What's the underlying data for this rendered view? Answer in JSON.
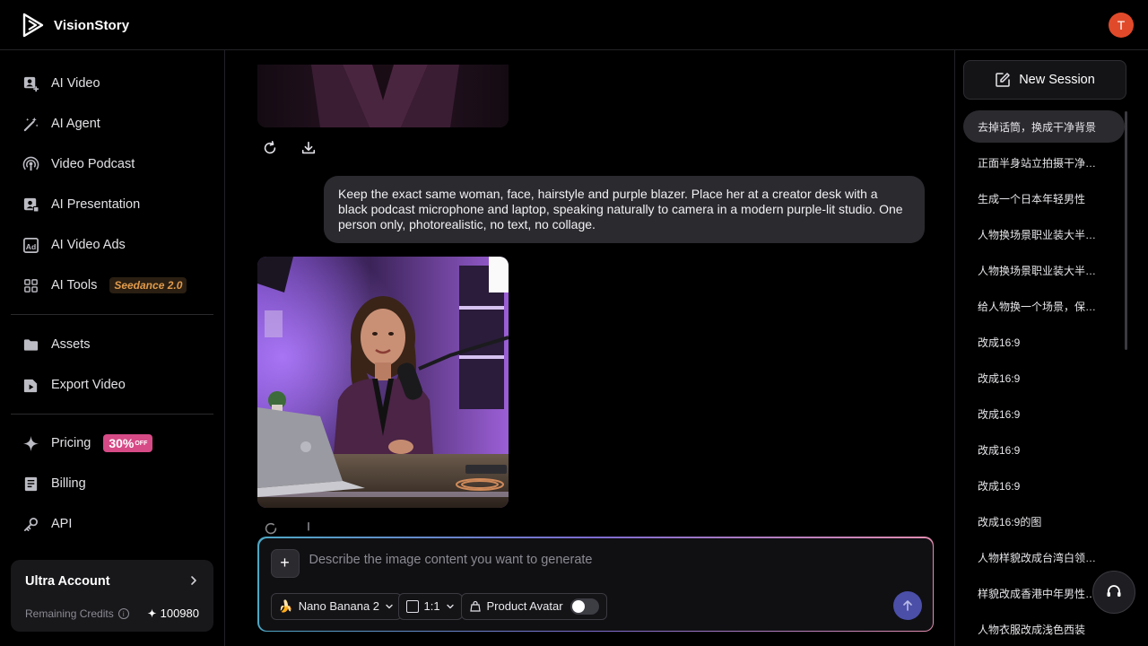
{
  "app": {
    "name": "VisionStory",
    "user_initial": "T"
  },
  "sidebar": {
    "items": [
      {
        "label": "AI Video",
        "icon": "user-video-icon"
      },
      {
        "label": "AI Agent",
        "icon": "magic-wand-icon"
      },
      {
        "label": "Video Podcast",
        "icon": "podcast-icon"
      },
      {
        "label": "AI Presentation",
        "icon": "presentation-icon"
      },
      {
        "label": "AI Video Ads",
        "icon": "ad-icon"
      },
      {
        "label": "AI Tools",
        "icon": "grid-icon",
        "badge": "Seedance 2.0"
      },
      {
        "label": "Assets",
        "icon": "folder-icon"
      },
      {
        "label": "Export Video",
        "icon": "export-video-icon"
      },
      {
        "label": "Pricing",
        "icon": "sparkle-icon",
        "badge": "30%",
        "badge_sub": "OFF"
      },
      {
        "label": "Billing",
        "icon": "billing-icon"
      },
      {
        "label": "API",
        "icon": "key-icon"
      }
    ],
    "account": {
      "title": "Ultra Account",
      "credits_label": "Remaining Credits",
      "credits": "100980"
    }
  },
  "chat": {
    "user_message": "Keep the exact same woman, face, hairstyle and purple blazer. Place her at a creator desk with a black podcast microphone and laptop, speaking naturally to camera in a modern purple-lit studio. One person only, photorealistic, no text, no collage."
  },
  "composer": {
    "placeholder": "Describe the image content you want to generate",
    "value": "",
    "model": "Nano Banana 2",
    "ratio": "1:1",
    "product_avatar_label": "Product Avatar",
    "product_avatar_on": false
  },
  "right_panel": {
    "new_session_label": "New Session",
    "sessions": [
      "去掉话筒，换成干净背景",
      "正面半身站立拍摄干净背景",
      "生成一个日本年轻男性",
      "人物换场景职业装大半身照",
      "人物换场景职业装大半身照",
      "给人物换一个场景，保持人物",
      "改成16:9",
      "改成16:9",
      "改成16:9",
      "改成16:9",
      "改成16:9",
      "改成16:9的图",
      "人物样貌改成台湾白领，保持",
      "样貌改成香港中年男性白领",
      "人物衣服改成浅色西装"
    ]
  },
  "colors": {
    "accent": "#4b4fa8",
    "avatar": "#e04a2a",
    "pricing_badge": "#d64a86",
    "seedance_badge": "#e09a4c"
  }
}
